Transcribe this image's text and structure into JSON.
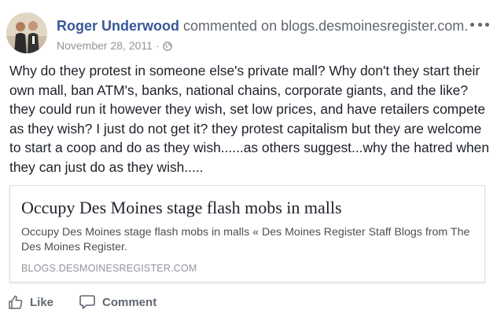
{
  "post": {
    "author": "Roger Underwood",
    "action_text": "commented on blogs.desmoinesregister.com.",
    "date": "November 28, 2011",
    "separator": "·",
    "privacy_icon": "globe-icon",
    "menu_icon": "more-horizontal-icon",
    "body": "Why do they protest in someone else's private mall? Why don't they start their own mall, ban ATM's, banks, national chains, corporate giants, and the like? they could run it however they wish, set low prices, and have retailers compete as they wish? I just do not get it? they protest capitalism but they are welcome to start a coop and do as they wish......as others suggest...why the hatred when they can just do as they wish....."
  },
  "link_card": {
    "title": "Occupy Des Moines stage flash mobs in malls",
    "description": "Occupy Des Moines stage flash mobs in malls « Des Moines Register Staff Blogs from The Des Moines Register.",
    "domain": "BLOGS.DESMOINESREGISTER.COM"
  },
  "actions": {
    "like_label": "Like",
    "like_icon": "thumbs-up-icon",
    "comment_label": "Comment",
    "comment_icon": "comment-icon"
  },
  "colors": {
    "author": "#385898",
    "action_text": "#616770",
    "meta": "#90949c",
    "body_text": "#1d2129",
    "card_border": "#dddfe2"
  }
}
